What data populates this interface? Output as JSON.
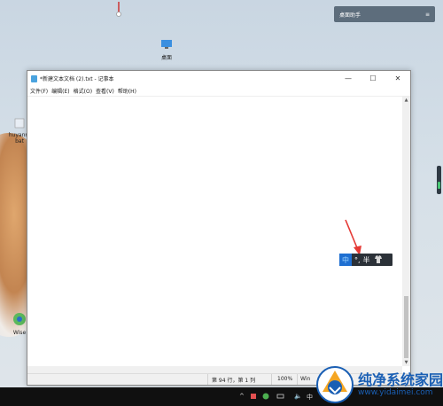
{
  "desktop": {
    "icons": [
      {
        "label": "桌面"
      },
      {
        "label": "huyanm"
      },
      {
        "label": "bat"
      },
      {
        "label": "Wise"
      }
    ],
    "widget_label": "桌面助手",
    "widget_menu_icon": "≡"
  },
  "notepad": {
    "title": "*新建文本文档 (2).txt - 记事本",
    "menu": [
      "文件(F)",
      "编辑(E)",
      "格式(O)",
      "查看(V)",
      "帮助(H)"
    ],
    "status": {
      "position": "第 94 行，第 1 列",
      "zoom": "100%",
      "encoding": "Win"
    }
  },
  "ime": {
    "mode": "中",
    "punct": "°,",
    "width": "半",
    "skin_icon": "shirt-icon"
  },
  "taskbar": {
    "tray_text": "中"
  },
  "watermark": {
    "title": "纯净系统家园",
    "url": "www.yidaimei.com"
  },
  "colors": {
    "accent": "#1f6fd1",
    "watermark": "#1a5fb4",
    "arrow": "#e53935"
  }
}
